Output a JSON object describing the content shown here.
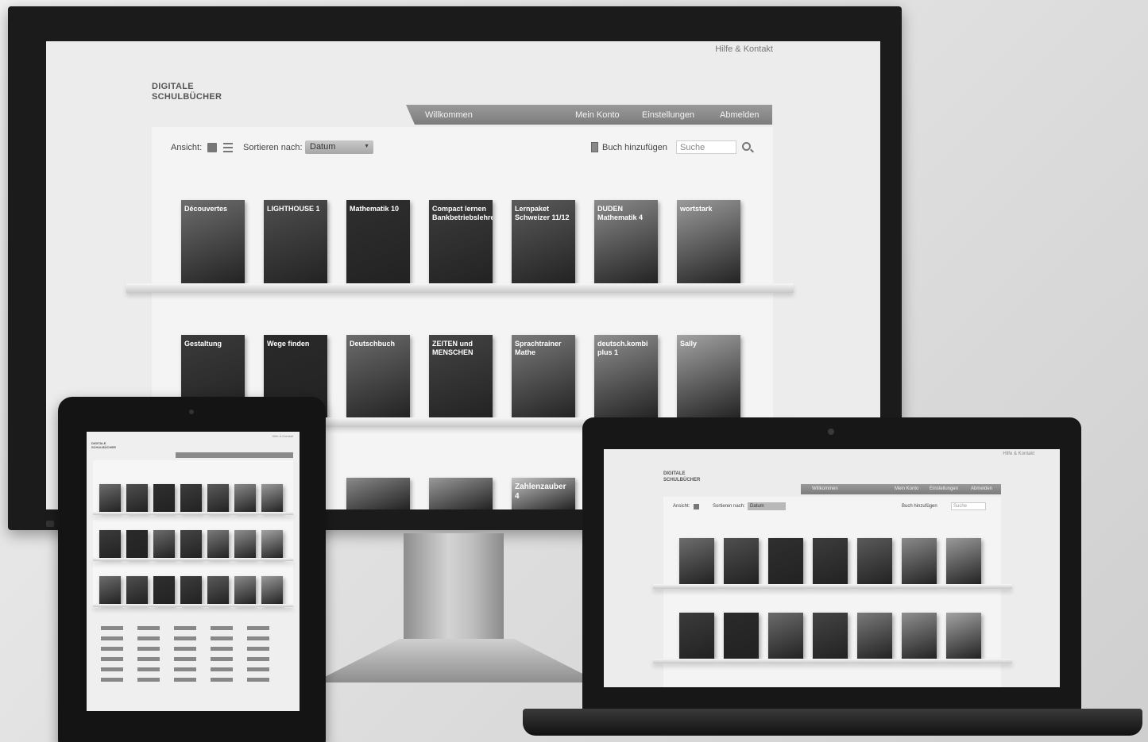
{
  "site": {
    "help_link": "Hilfe & Kontakt",
    "brand_line1": "DIGITALE",
    "brand_line2": "SCHULBÜCHER"
  },
  "nav": {
    "welcome": "Willkommen",
    "account": "Mein Konto",
    "settings": "Einstellungen",
    "logout": "Abmelden"
  },
  "toolbar": {
    "view_label": "Ansicht:",
    "sort_label": "Sortieren nach:",
    "sort_value": "Datum",
    "add_book": "Buch hinzufügen",
    "search_placeholder": "Suche"
  },
  "shelf1": [
    {
      "title": "Découvertes",
      "color": "#6d6d6d"
    },
    {
      "title": "LIGHTHOUSE 1",
      "color": "#4f4f4f"
    },
    {
      "title": "Mathematik 10",
      "color": "#2f2f2f"
    },
    {
      "title": "Compact lernen Bankbetriebslehre",
      "color": "#3c3c3c"
    },
    {
      "title": "Lernpaket Schweizer 11/12",
      "color": "#5a5a5a"
    },
    {
      "title": "DUDEN Mathematik 4",
      "color": "#8a8a8a"
    },
    {
      "title": "wortstark",
      "color": "#9a9a9a"
    }
  ],
  "shelf2": [
    {
      "title": "Gestaltung",
      "color": "#3b3b3b"
    },
    {
      "title": "Wege finden",
      "color": "#2a2a2a"
    },
    {
      "title": "Deutschbuch",
      "color": "#6b6b6b"
    },
    {
      "title": "ZEITEN und MENSCHEN",
      "color": "#444444"
    },
    {
      "title": "Sprachtrainer Mathe",
      "color": "#7a7a7a"
    },
    {
      "title": "deutsch.kombi plus 1",
      "color": "#8f8f8f"
    },
    {
      "title": "Sally",
      "color": "#a3a3a3"
    }
  ],
  "shelf3": [
    {
      "title": "",
      "color": "#8a8a8a"
    },
    {
      "title": "",
      "color": "#9a9a9a"
    },
    {
      "title": "Zahlenzauber 4",
      "color": "#c4c4c4"
    }
  ]
}
